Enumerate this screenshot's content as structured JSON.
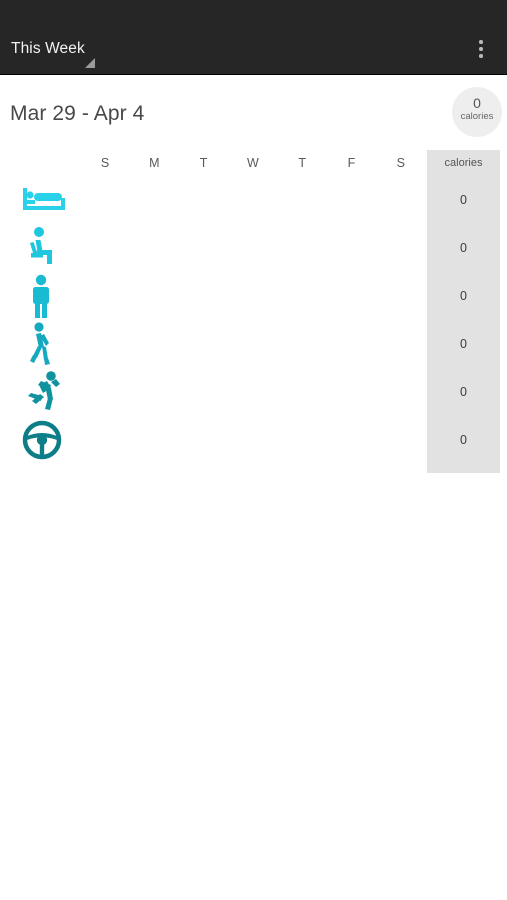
{
  "appbar": {
    "title": "This Week",
    "spinner_icon": "dropdown-triangle-icon",
    "overflow_icon": "more-vertical-icon"
  },
  "header": {
    "date_range": "Mar 29 - Apr 4",
    "total_badge": {
      "value": "0",
      "unit": "calories"
    }
  },
  "grid": {
    "day_headers": [
      "S",
      "M",
      "T",
      "W",
      "T",
      "F",
      "S"
    ],
    "calories_column_header": "calories",
    "rows": [
      {
        "activity": "sleeping",
        "icon": "bed-icon",
        "color": "#29d2e8",
        "calories": "0"
      },
      {
        "activity": "sitting",
        "icon": "sitting-person-icon",
        "color": "#1ec6de",
        "calories": "0"
      },
      {
        "activity": "standing",
        "icon": "standing-person-icon",
        "color": "#19bbd2",
        "calories": "0"
      },
      {
        "activity": "walking",
        "icon": "walking-person-icon",
        "color": "#14a9bf",
        "calories": "0"
      },
      {
        "activity": "running",
        "icon": "running-person-icon",
        "color": "#11939f",
        "calories": "0"
      },
      {
        "activity": "driving",
        "icon": "steering-wheel-icon",
        "color": "#0d7d87",
        "calories": "0"
      }
    ]
  },
  "colors": {
    "appbar_background": "#262626",
    "page_background": "#ffffff",
    "calories_column_background": "#e2e2e2",
    "badge_background": "#eeeeee"
  }
}
